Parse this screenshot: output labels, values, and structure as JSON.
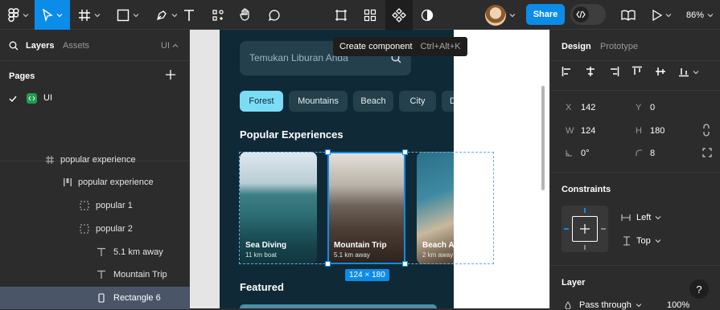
{
  "toolbar": {
    "share_label": "Share",
    "zoom_label": "86%",
    "tooltip_label": "Create component",
    "tooltip_shortcut": "Ctrl+Alt+K"
  },
  "left_panel": {
    "tabs": [
      "Layers",
      "Assets"
    ],
    "page_selector": "UI",
    "pages_title": "Pages",
    "pages": [
      {
        "name": "UI",
        "selected": true
      }
    ],
    "layers": [
      {
        "name": "popular experience",
        "indent": 1,
        "icon": "frame-icon"
      },
      {
        "name": "popular experience",
        "indent": 2,
        "icon": "auto-layout-icon"
      },
      {
        "name": "popular 1",
        "indent": 3,
        "icon": "dashed-frame-icon"
      },
      {
        "name": "popular 2",
        "indent": 3,
        "icon": "dashed-frame-icon"
      },
      {
        "name": "5.1 km away",
        "indent": 4,
        "icon": "text-icon"
      },
      {
        "name": "Mountain Trip",
        "indent": 4,
        "icon": "text-icon"
      },
      {
        "name": "Rectangle 6",
        "indent": 4,
        "icon": "rectangle-icon",
        "selected": true
      }
    ]
  },
  "canvas": {
    "search_placeholder": "Temukan Liburan Anda",
    "chips": [
      "Forest",
      "Mountains",
      "Beach",
      "City",
      "D"
    ],
    "section_popular": "Popular Experiences",
    "section_featured": "Featured",
    "cards": [
      {
        "title": "Sea Diving",
        "subtitle": "11 km boat"
      },
      {
        "title": "Mountain Trip",
        "subtitle": "5.1 km away"
      },
      {
        "title": "Beach A",
        "subtitle": "2 km away"
      }
    ],
    "size_badge": "124 × 180"
  },
  "right_panel": {
    "tabs": [
      "Design",
      "Prototype"
    ],
    "x_label": "X",
    "x_value": "142",
    "y_label": "Y",
    "y_value": "0",
    "w_label": "W",
    "w_value": "124",
    "h_label": "H",
    "h_value": "180",
    "rotation_value": "0°",
    "radius_value": "8",
    "constraints_title": "Constraints",
    "constraint_h": "Left",
    "constraint_v": "Top",
    "layer_title": "Layer",
    "blend_mode": "Pass through",
    "opacity": "100%",
    "help_label": "?"
  },
  "colors": {
    "accent": "#0c8ce9",
    "chip_active": "#7bdcf5",
    "component": "#1f9d55"
  }
}
